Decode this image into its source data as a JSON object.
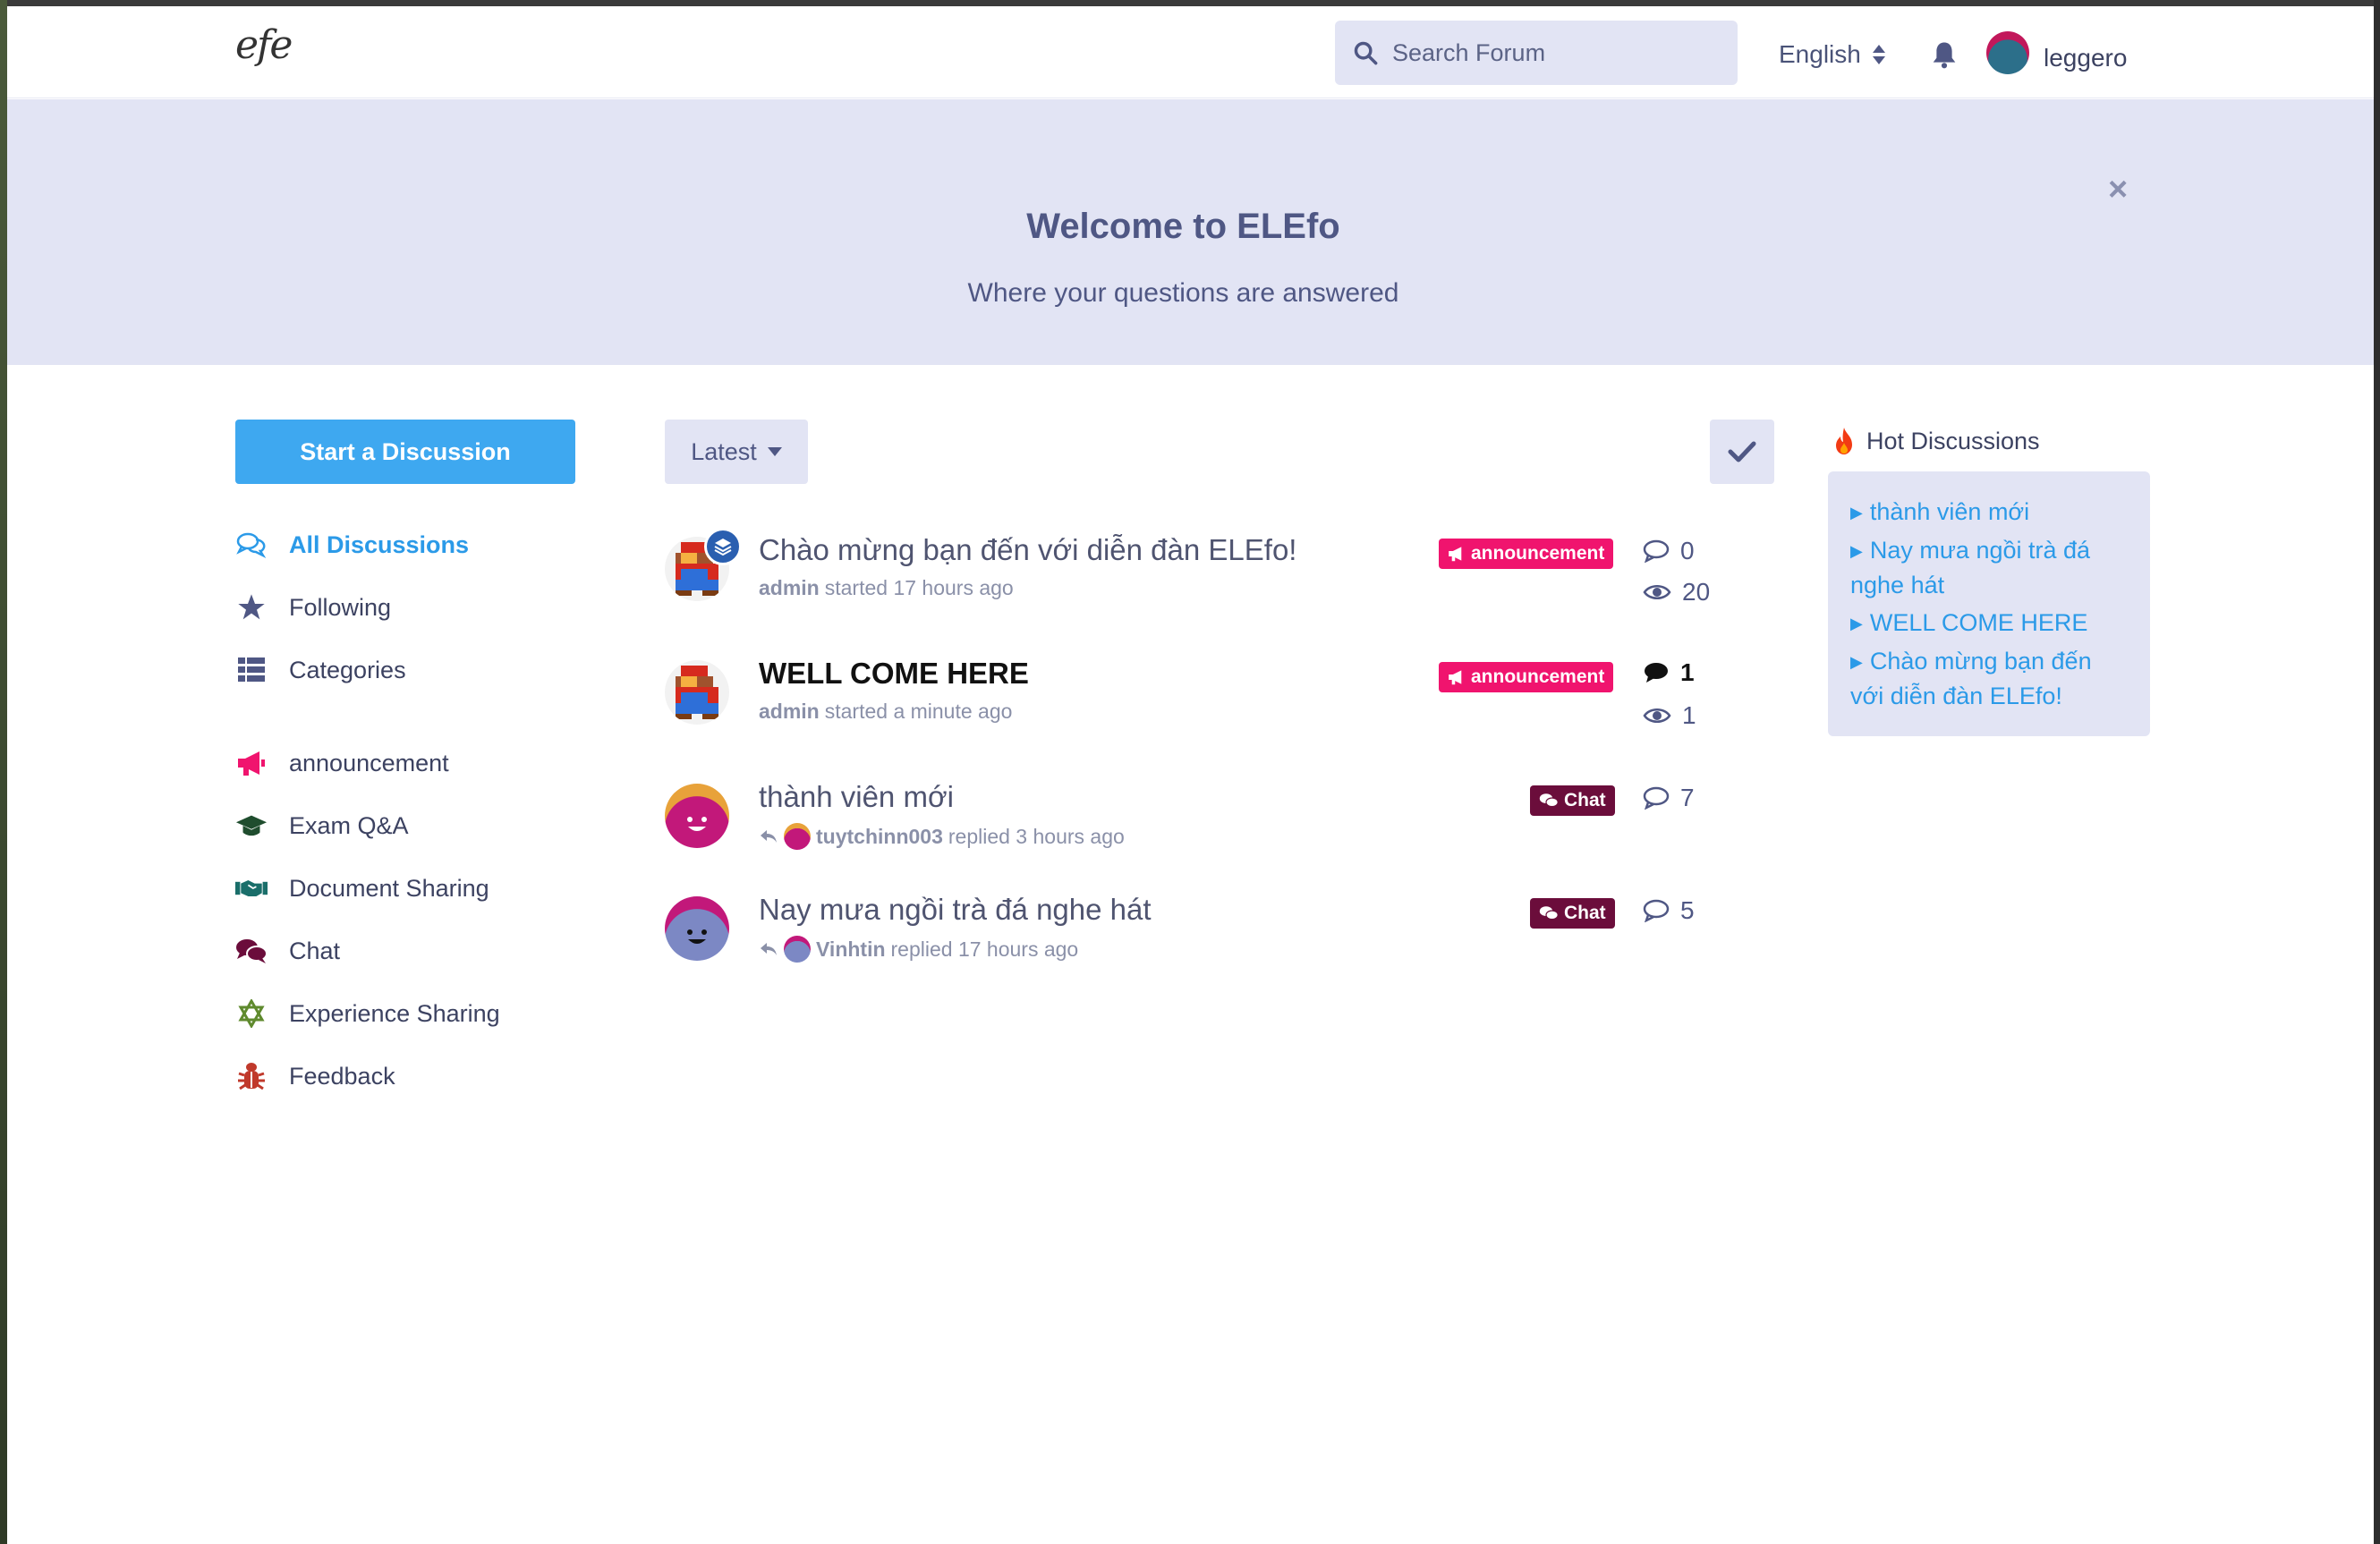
{
  "header": {
    "logo_text": "efe",
    "search_placeholder": "Search Forum",
    "language": "English",
    "username": "leggero"
  },
  "hero": {
    "title": "Welcome to ELEfo",
    "subtitle": "Where your questions are answered",
    "close_symbol": "×"
  },
  "sidebar": {
    "start_label": "Start a Discussion",
    "nav": [
      {
        "label": "All Discussions",
        "icon": "comments-icon"
      },
      {
        "label": "Following",
        "icon": "star-icon"
      },
      {
        "label": "Categories",
        "icon": "categories-icon"
      }
    ],
    "tags": [
      {
        "label": "announcement",
        "icon": "megaphone-icon",
        "color": "#f0146e"
      },
      {
        "label": "Exam Q&A",
        "icon": "graduation-cap-icon",
        "color": "#1f4d2e"
      },
      {
        "label": "Document Sharing",
        "icon": "handshake-icon",
        "color": "#1a6e6a"
      },
      {
        "label": "Chat",
        "icon": "chat-bubbles-icon",
        "color": "#6b0d3b"
      },
      {
        "label": "Experience Sharing",
        "icon": "star-of-david-icon",
        "color": "#5f8a2e"
      },
      {
        "label": "Feedback",
        "icon": "bug-icon",
        "color": "#c0392b"
      }
    ]
  },
  "toolbar": {
    "sort_label": "Latest"
  },
  "discussions": [
    {
      "title": "Chào mừng bạn đến với diễn đàn ELEfo!",
      "author": "admin",
      "action": "started 17 hours ago",
      "tag": "announcement",
      "replies": "0",
      "views": "20"
    },
    {
      "title": "WELL COME HERE",
      "author": "admin",
      "action": "started a minute ago",
      "tag": "announcement",
      "replies": "1",
      "views": "1"
    },
    {
      "title": "thành viên mới",
      "author": "tuytchinn003",
      "action": "replied 3 hours ago",
      "tag": "Chat",
      "replies": "7"
    },
    {
      "title": "Nay mưa ngồi trà đá nghe hát",
      "author": "Vinhtin",
      "action": "replied 17 hours ago",
      "tag": "Chat",
      "replies": "5"
    }
  ],
  "hot": {
    "title": "Hot Discussions",
    "links": [
      "thành viên mới",
      "Nay mưa ngồi trà đá nghe hát",
      "WELL COME HERE",
      "Chào mừng bạn đến với diễn đàn ELEfo!"
    ]
  },
  "colors": {
    "accent": "#3ea8f0",
    "hero_bg": "#e2e4f4",
    "announcement": "#f0146e",
    "chat": "#6b0d3b"
  }
}
